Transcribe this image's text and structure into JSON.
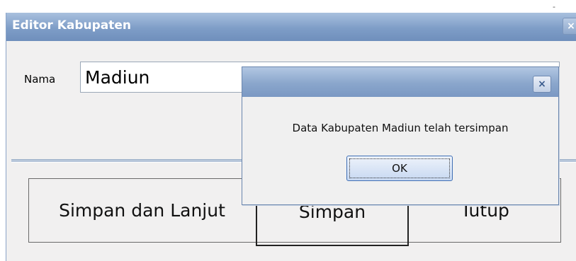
{
  "window": {
    "title": "Editor Kabupaten",
    "close_glyph": "×",
    "corner_mark": "-"
  },
  "form": {
    "name_label": "Nama",
    "name_value": "Madiun"
  },
  "buttons": {
    "save_continue": "Simpan dan Lanjut",
    "save": "Simpan",
    "close": "Tutup"
  },
  "dialog": {
    "close_glyph": "×",
    "message": "Data Kabupaten Madiun telah tersimpan",
    "ok_label": "OK"
  },
  "colors": {
    "titlebar": "#7e9dc7",
    "titlebar_text": "#ffffff",
    "window_bg": "#f1f0f0"
  },
  "icons": {
    "window_close": "close-icon",
    "dialog_close": "close-icon"
  }
}
